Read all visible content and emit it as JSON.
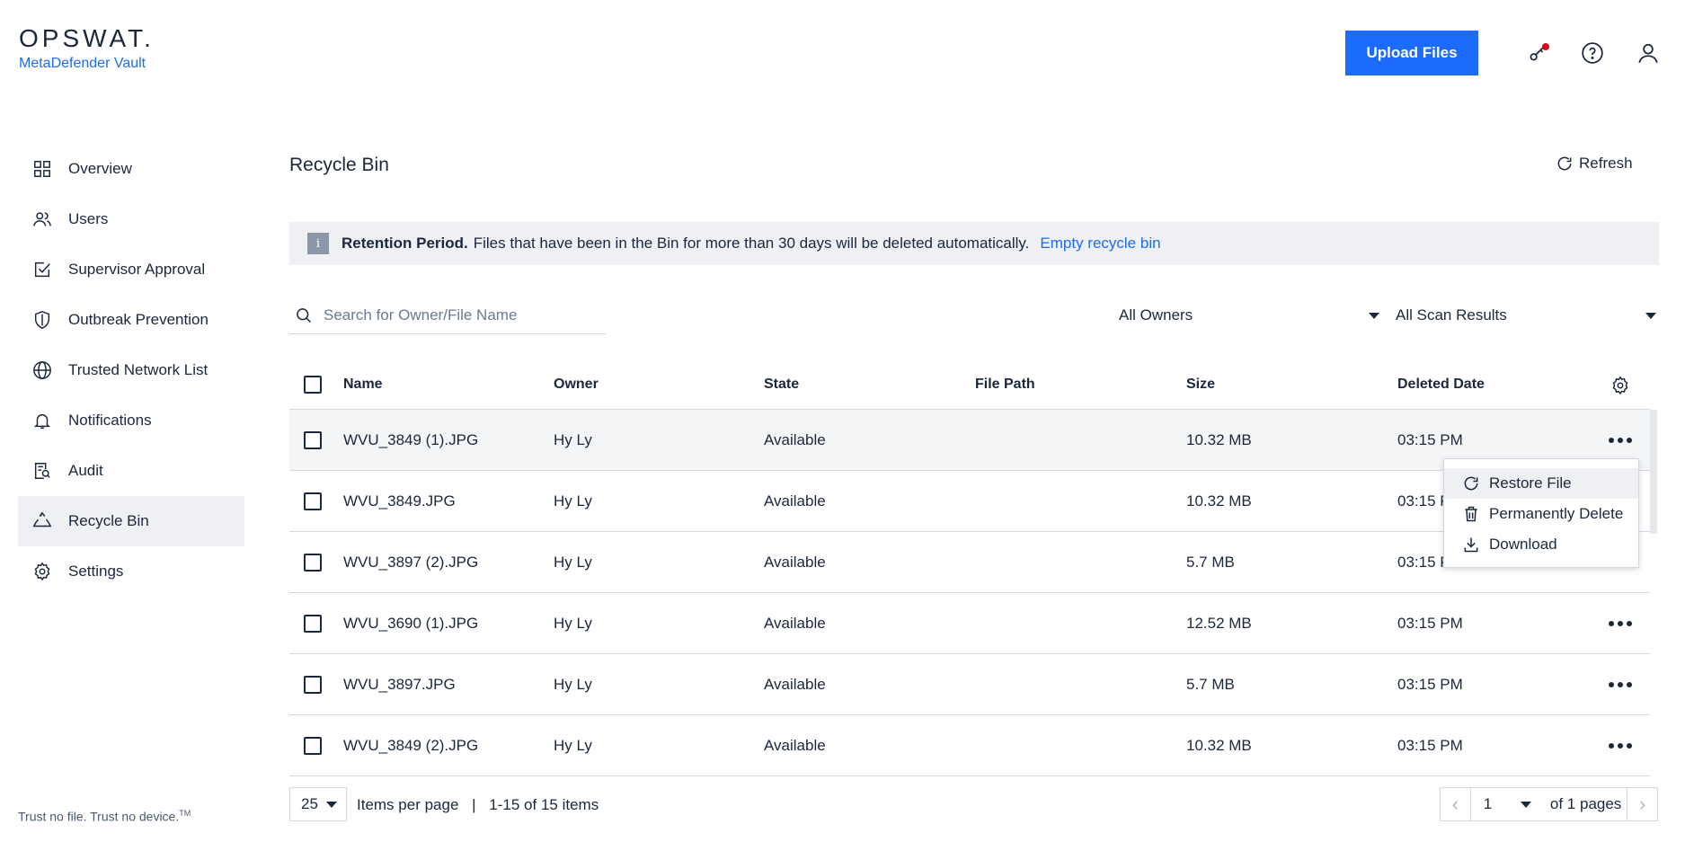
{
  "header": {
    "logo": "OPSWAT.",
    "product": "MetaDefender Vault",
    "upload_label": "Upload Files",
    "icons": [
      "key-icon",
      "help-icon",
      "user-icon"
    ],
    "accent_color": "#1d6bfc"
  },
  "sidebar": {
    "items": [
      {
        "label": "Overview",
        "icon": "grid-icon"
      },
      {
        "label": "Users",
        "icon": "users-icon"
      },
      {
        "label": "Supervisor Approval",
        "icon": "approval-icon"
      },
      {
        "label": "Outbreak Prevention",
        "icon": "shield-icon"
      },
      {
        "label": "Trusted Network List",
        "icon": "globe-icon"
      },
      {
        "label": "Notifications",
        "icon": "bell-icon"
      },
      {
        "label": "Audit",
        "icon": "audit-icon"
      },
      {
        "label": "Recycle Bin",
        "icon": "recycle-icon",
        "active": true
      },
      {
        "label": "Settings",
        "icon": "gear-icon"
      }
    ],
    "footer": "Trust no file. Trust no device.",
    "footer_mark": "TM"
  },
  "main": {
    "title": "Recycle Bin",
    "refresh_label": "Refresh",
    "banner": {
      "bold": "Retention Period.",
      "text": "Files that have been in the Bin for more than 30 days will be deleted automatically.",
      "link": "Empty recycle bin"
    },
    "search_placeholder": "Search for Owner/File Name",
    "owners_filter": "All Owners",
    "scan_filter": "All Scan Results",
    "columns": [
      "Name",
      "Owner",
      "State",
      "File Path",
      "Size",
      "Deleted Date"
    ],
    "rows": [
      {
        "name": "WVU_3849 (1).JPG",
        "owner": "Hy Ly",
        "state": "Available",
        "path": "",
        "size": "10.32 MB",
        "date": "03:15 PM"
      },
      {
        "name": "WVU_3849.JPG",
        "owner": "Hy Ly",
        "state": "Available",
        "path": "",
        "size": "10.32 MB",
        "date": "03:15 P"
      },
      {
        "name": "WVU_3897 (2).JPG",
        "owner": "Hy Ly",
        "state": "Available",
        "path": "",
        "size": "5.7 MB",
        "date": "03:15 P"
      },
      {
        "name": "WVU_3690 (1).JPG",
        "owner": "Hy Ly",
        "state": "Available",
        "path": "",
        "size": "12.52 MB",
        "date": "03:15 PM"
      },
      {
        "name": "WVU_3897.JPG",
        "owner": "Hy Ly",
        "state": "Available",
        "path": "",
        "size": "5.7 MB",
        "date": "03:15 PM"
      },
      {
        "name": "WVU_3849 (2).JPG",
        "owner": "Hy Ly",
        "state": "Available",
        "path": "",
        "size": "10.32 MB",
        "date": "03:15 PM"
      }
    ],
    "context_menu": {
      "restore": "Restore File",
      "delete": "Permanently Delete",
      "download": "Download"
    },
    "pagination": {
      "per_page": "25",
      "per_page_label": "Items per page",
      "separator": "|",
      "range": "1-15 of 15 items",
      "page": "1",
      "of_pages": "of 1 pages"
    }
  }
}
